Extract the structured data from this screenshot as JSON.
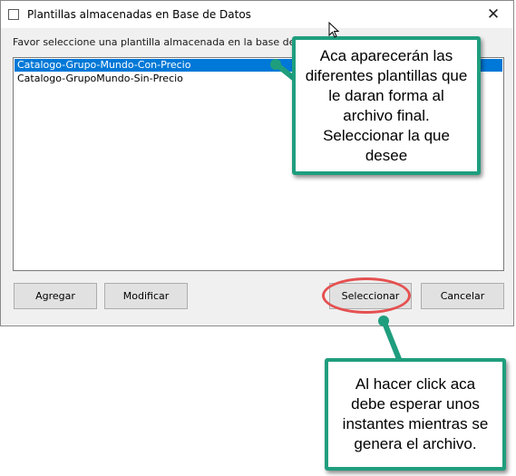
{
  "window": {
    "title": "Plantillas almacenadas en Base de Datos",
    "close_glyph": "✕",
    "prompt": "Favor seleccione una plantilla almacenada en la base de",
    "list": {
      "items": [
        {
          "label": "Catalogo-Grupo-Mundo-Con-Precio",
          "selected": true
        },
        {
          "label": "Catalogo-GrupoMundo-Sin-Precio",
          "selected": false
        }
      ]
    },
    "buttons": {
      "add": "Agregar",
      "edit": "Modificar",
      "select": "Seleccionar",
      "cancel": "Cancelar"
    }
  },
  "annotations": {
    "top_callout": "Aca aparecerán las diferentes plantillas que le daran forma al archivo final. Seleccionar la que desee",
    "bottom_callout": "Al hacer click aca debe esperar unos instantes mientras se genera el archivo."
  },
  "colors": {
    "selection": "#0078d7",
    "callout_border": "#1f9e7e",
    "highlight_ring": "#e55050"
  }
}
